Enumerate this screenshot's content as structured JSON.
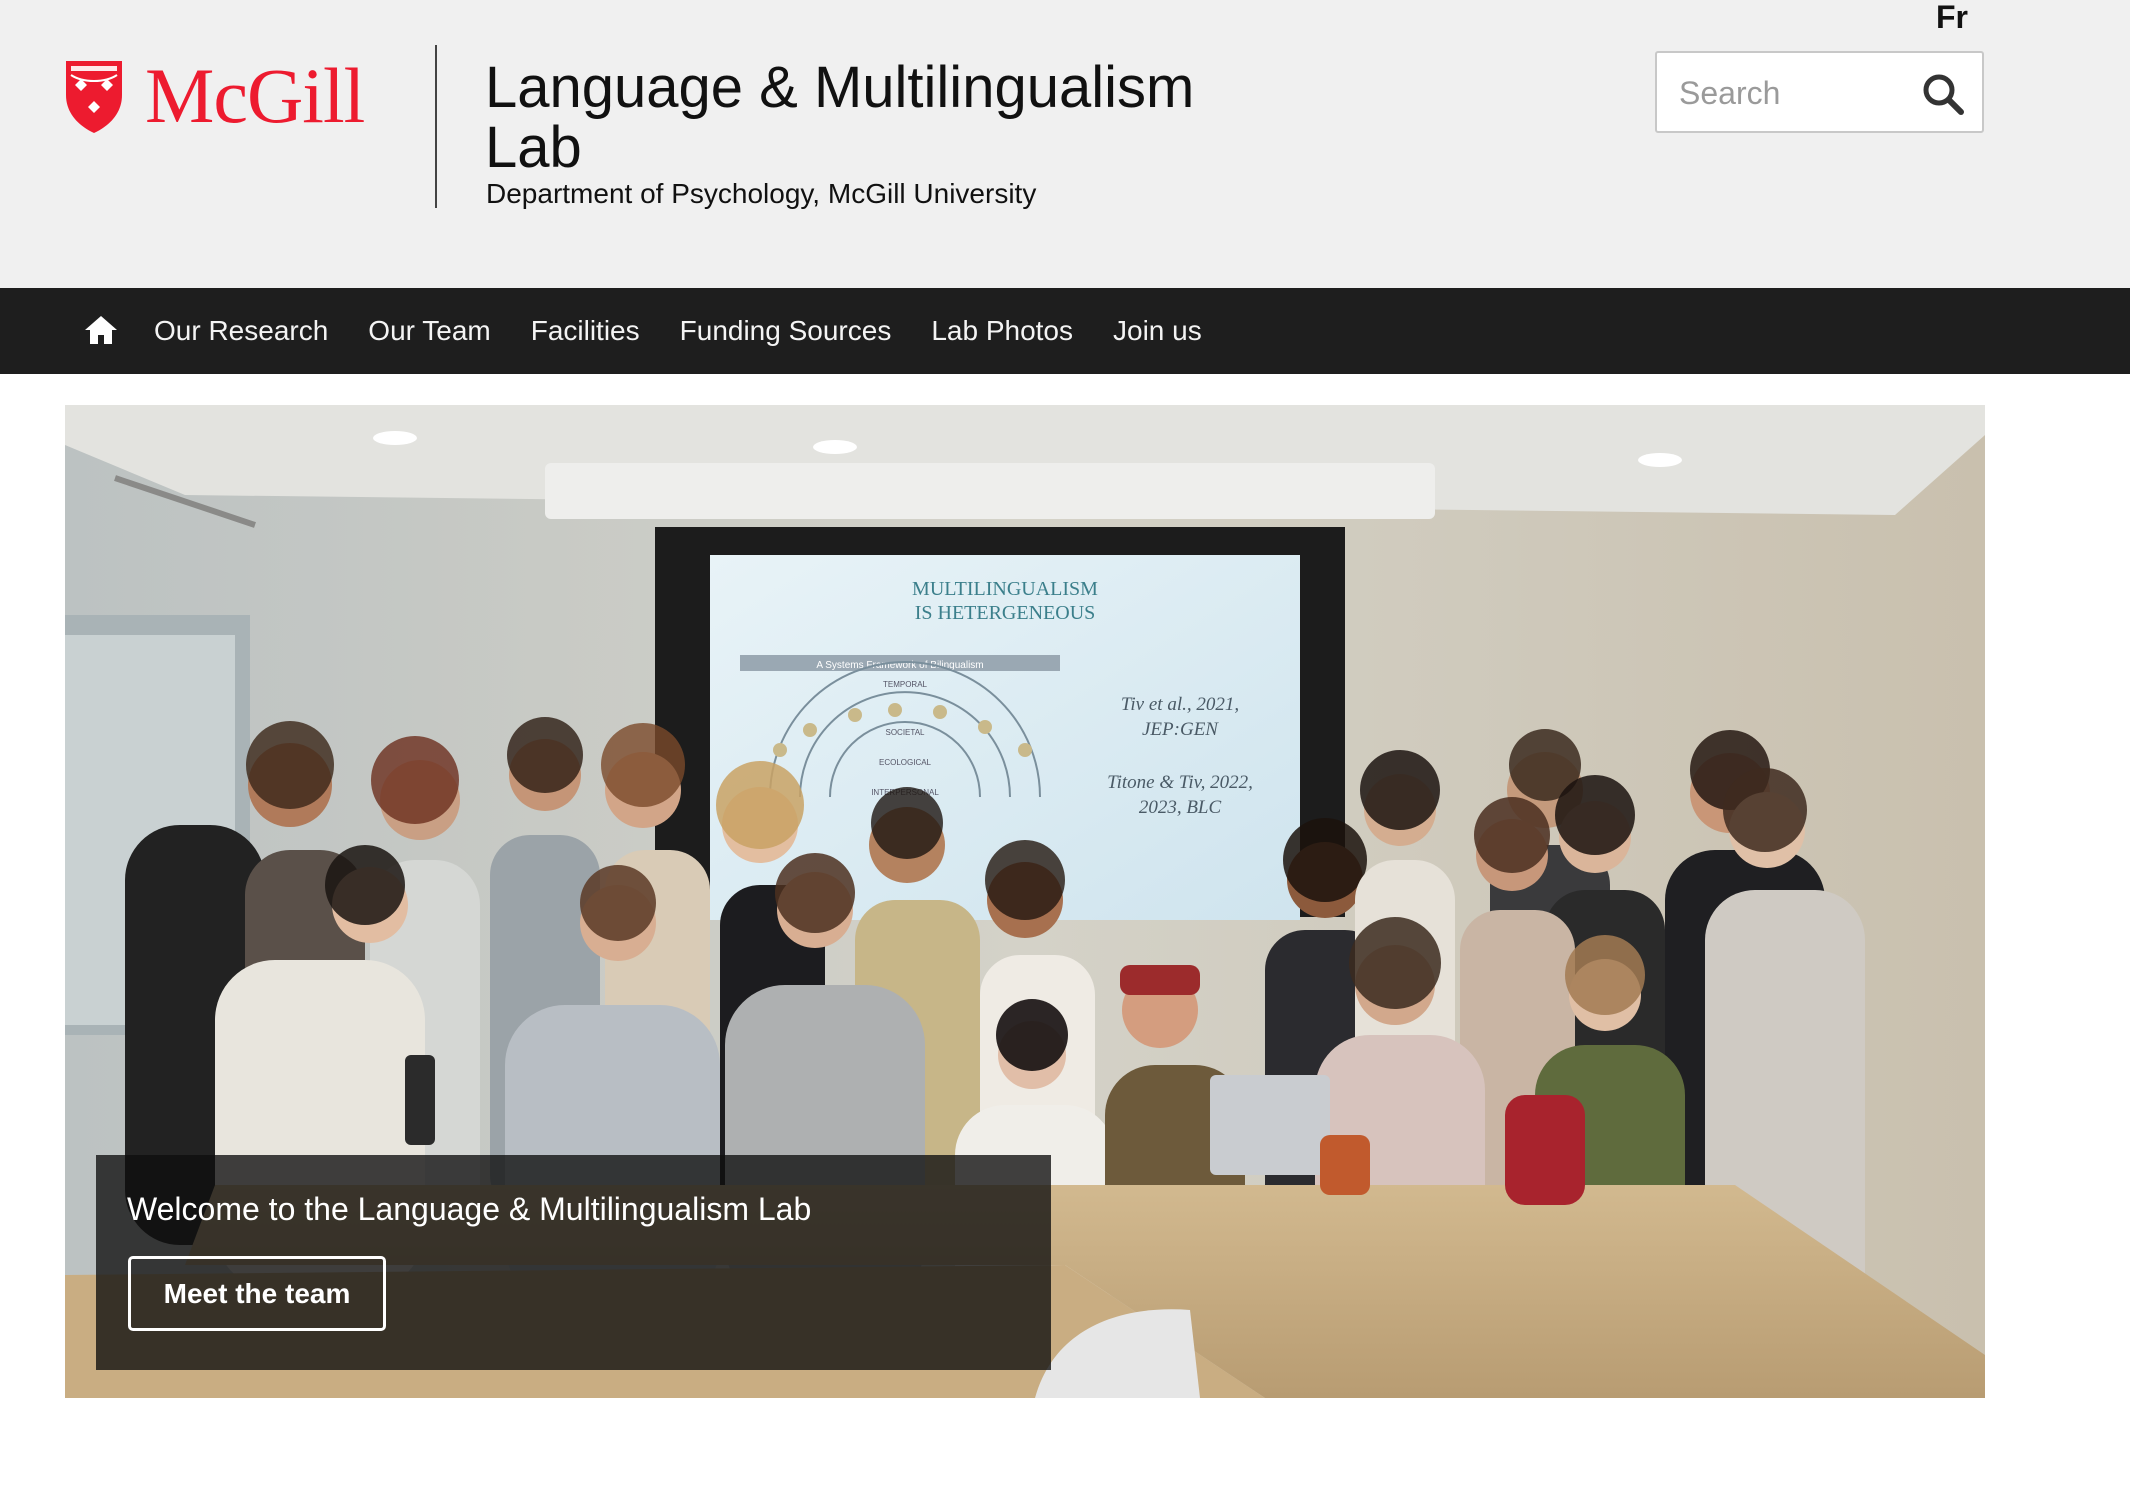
{
  "header": {
    "language_toggle": "Fr",
    "logo_text": "McGill",
    "site_title": "Language & Multilingualism Lab",
    "site_subtitle": "Department of Psychology, McGill University",
    "search_placeholder": "Search"
  },
  "nav": {
    "home_icon": "home-icon",
    "items": [
      {
        "label": "Our Research"
      },
      {
        "label": "Our Team"
      },
      {
        "label": "Facilities"
      },
      {
        "label": "Funding Sources"
      },
      {
        "label": "Lab Photos"
      },
      {
        "label": "Join us"
      }
    ]
  },
  "hero": {
    "screen_slide": {
      "title_line1": "MULTILINGUALISM",
      "title_line2": "IS HETERGENEOUS",
      "framework_banner": "A Systems Framework of Bilingualism",
      "levels": [
        "TEMPORAL",
        "SOCIETAL",
        "ECOLOGICAL",
        "INTERPERSONAL"
      ],
      "citation1_line1": "Tiv et al., 2021,",
      "citation1_line2": "JEP:GEN",
      "citation2_line1": "Titone & Tiv, 2022,",
      "citation2_line2": "2023, BLC"
    },
    "caption": "Welcome to the Language & Multilingualism Lab",
    "button_label": "Meet the team"
  },
  "colors": {
    "mcgill_red": "#ed1b2f",
    "nav_background": "#1e1e1e",
    "header_background": "#f0f0f0"
  }
}
